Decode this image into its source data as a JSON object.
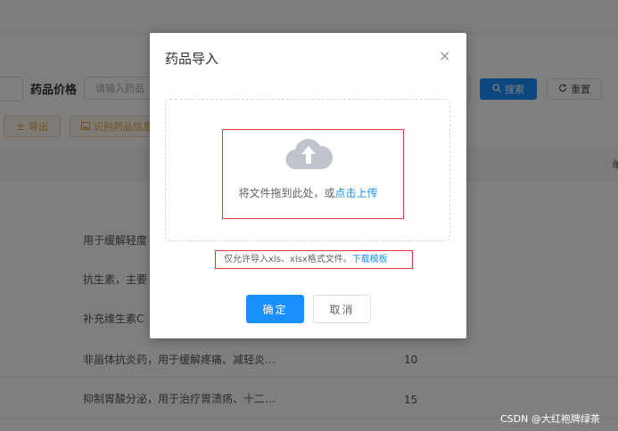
{
  "search": {
    "price_label": "药品价格",
    "price_placeholder": "请输入药品",
    "search_button": "搜索",
    "reset_button": "重置"
  },
  "toolbar": {
    "export_button": "导出",
    "recognize_button": "识别药品信息"
  },
  "table": {
    "header_stub": "单",
    "rows": [
      {
        "left": "",
        "desc": "",
        "num": ""
      },
      {
        "left": "",
        "desc": "用于缓解轻度",
        "num": ""
      },
      {
        "left": "",
        "desc": "抗生素，主要",
        "num": ""
      },
      {
        "left": "",
        "desc": "补充维生素C",
        "num": ""
      },
      {
        "left": "",
        "desc": "非甾体抗炎药，用于缓解疼痛、减轻炎…",
        "num": "10"
      },
      {
        "left": "",
        "desc": "抑制胃酸分泌，用于治疗胃溃疡、十二…",
        "num": "15"
      }
    ]
  },
  "dialog": {
    "title": "药品导入",
    "close": "×",
    "drop_text": "将文件拖到此处，或",
    "drop_link": "点击上传",
    "tip_text": "仅允许导入xls、xlsx格式文件。",
    "tip_link": "下载模板",
    "ok_button": "确定",
    "cancel_button": "取消"
  },
  "watermark": "CSDN @大红袍牌绿茶",
  "colors": {
    "primary": "#1890ff",
    "warning": "#e6a23c",
    "highlight": "#e53935"
  }
}
